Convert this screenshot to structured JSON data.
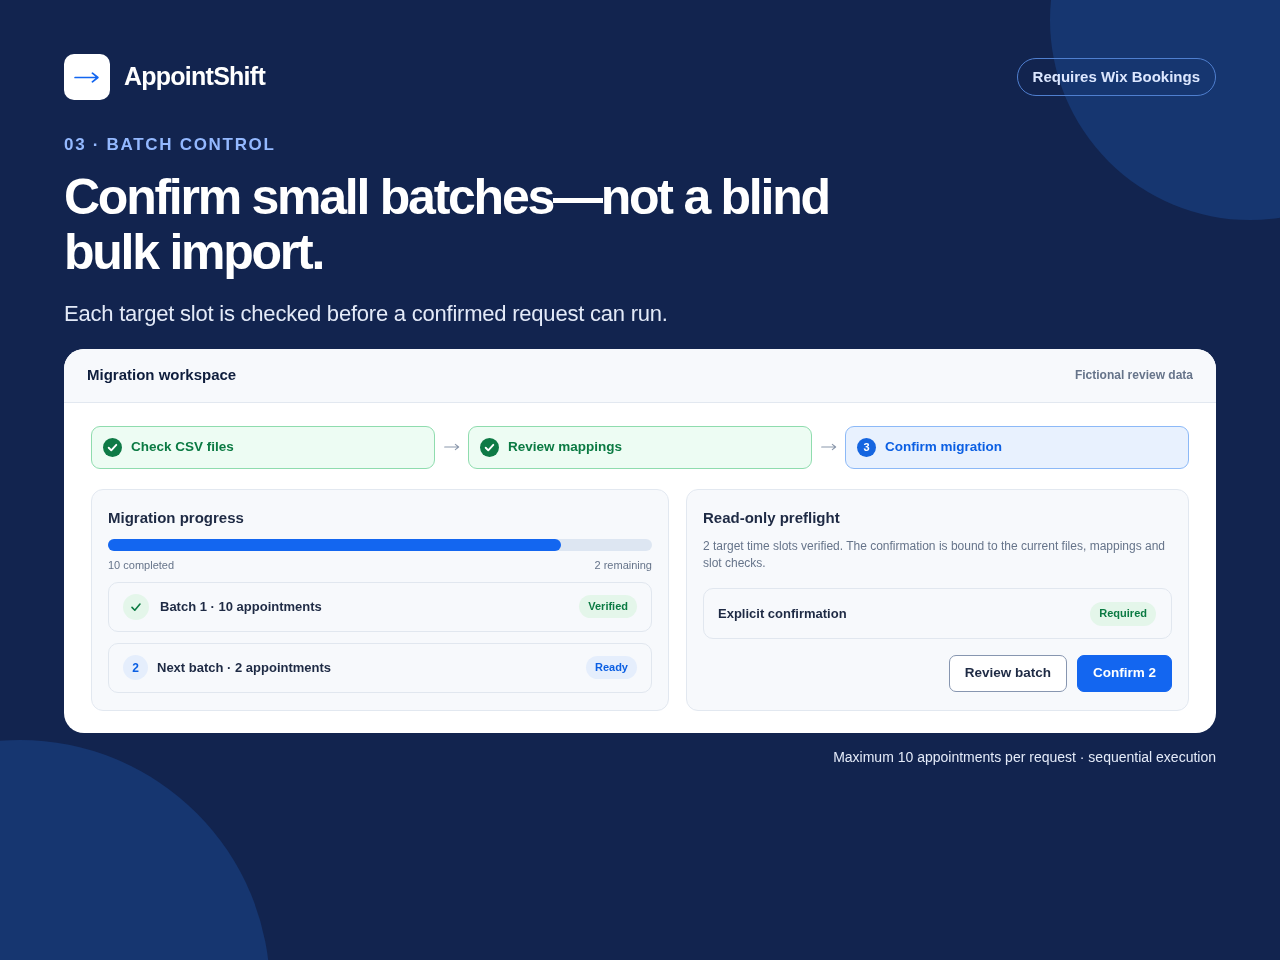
{
  "brand": {
    "name": "AppointShift"
  },
  "requirement_badge": "Requires Wix Bookings",
  "eyebrow": "03 · BATCH CONTROL",
  "headline": "Confirm small batches—not a blind bulk import.",
  "subtitle": "Each target slot is checked before a confirmed request can run.",
  "workspace": {
    "title": "Migration workspace",
    "note": "Fictional review data",
    "steps": [
      {
        "label": "Check CSV files",
        "completed": true
      },
      {
        "label": "Review mappings",
        "completed": true
      },
      {
        "label": "Confirm migration",
        "completed": false,
        "number": "3"
      }
    ],
    "progress": {
      "title": "Migration progress",
      "level": 0.833,
      "completed": "10 completed",
      "remaining": "2 remaining",
      "batches": [
        {
          "kind": "verified",
          "title": "Batch 1 · 10 appointments",
          "status": "Verified"
        },
        {
          "kind": "ready",
          "number": "2",
          "title": "Next batch · 2 appointments",
          "status": "Ready"
        }
      ]
    },
    "preflight": {
      "title": "Read-only preflight",
      "description": "2 target time slots verified. The confirmation is bound to the current files, mappings and slot checks.",
      "confirmation": {
        "label": "Explicit confirmation",
        "badge": "Required"
      },
      "buttons": [
        {
          "label": "Review batch",
          "kind": "secondary"
        },
        {
          "label": "Confirm 2",
          "kind": "primary"
        }
      ]
    }
  },
  "footer_note": "Maximum 10 appointments per request · sequential execution"
}
